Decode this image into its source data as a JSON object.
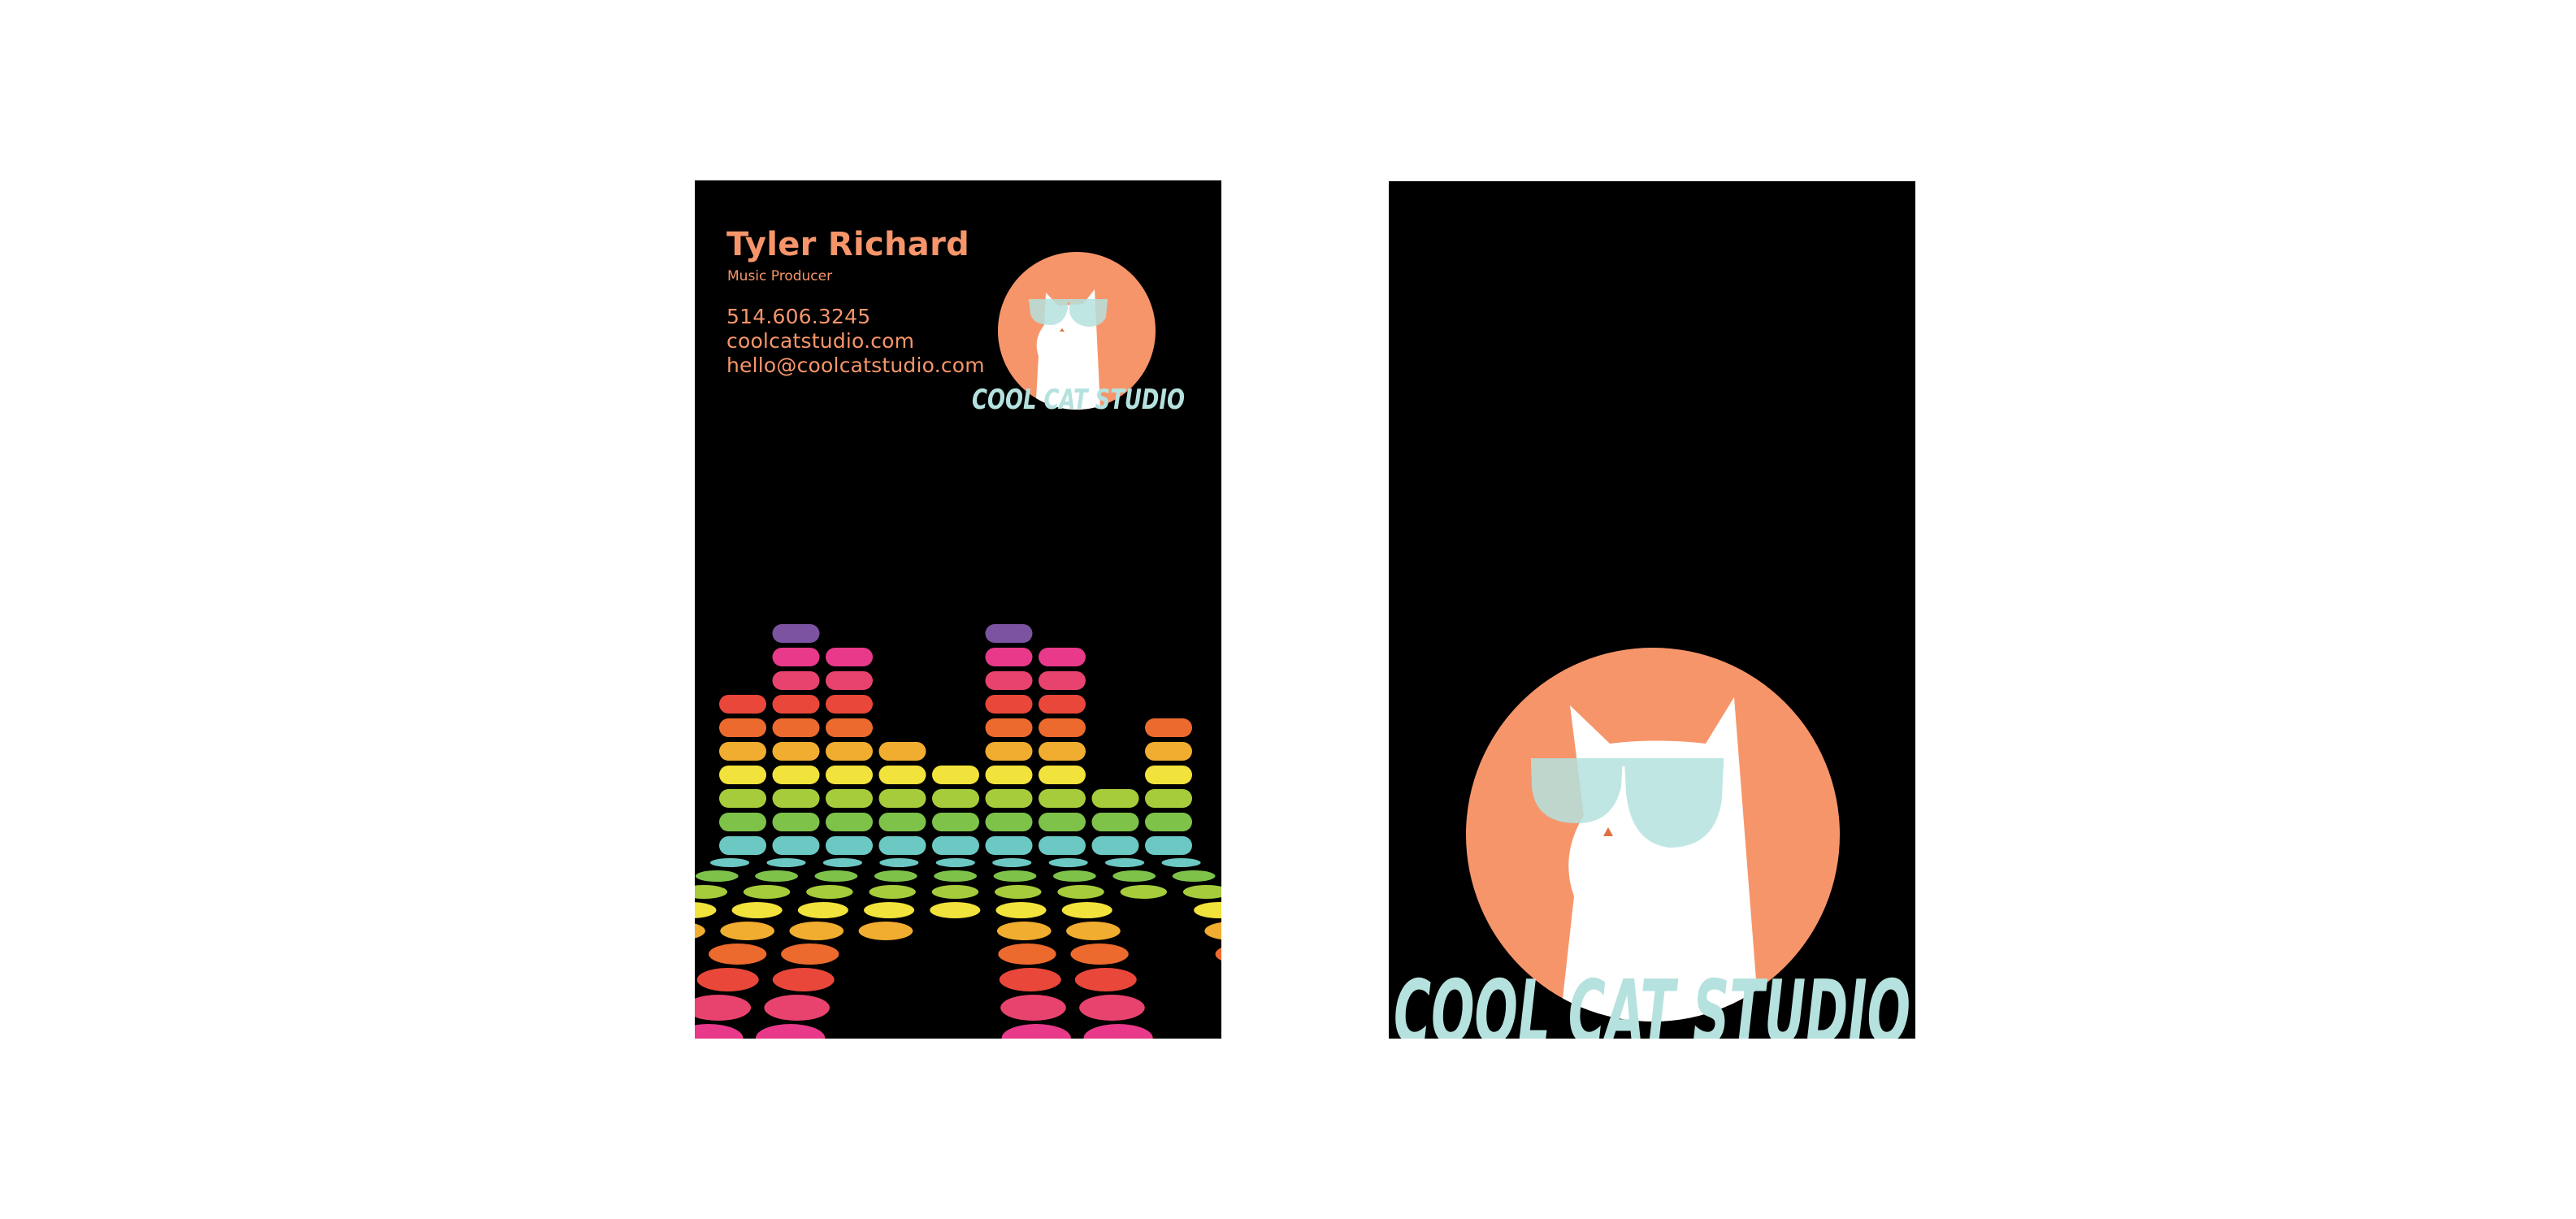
{
  "front": {
    "name": "Tyler Richard",
    "role": "Music Producer",
    "phone": "514.606.3245",
    "website": "coolcatstudio.com",
    "email": "hello@coolcatstudio.com",
    "logo_text": "COOL CAT STUDIO"
  },
  "back": {
    "logo_text": "COOL CAT STUDIO"
  },
  "colors": {
    "background": "#000000",
    "accent": "#f7956a",
    "glasses": "#b5e2de",
    "equalizer": [
      "#7b53a0",
      "#e8398a",
      "#e8436e",
      "#e9473a",
      "#ec6a2e",
      "#f0ad2f",
      "#f2e23c",
      "#a6cc3b",
      "#7ec24a",
      "#6bc8c3"
    ]
  },
  "equalizer": {
    "column_levels": [
      7,
      10,
      9,
      5,
      4,
      10,
      9,
      3,
      6
    ]
  }
}
